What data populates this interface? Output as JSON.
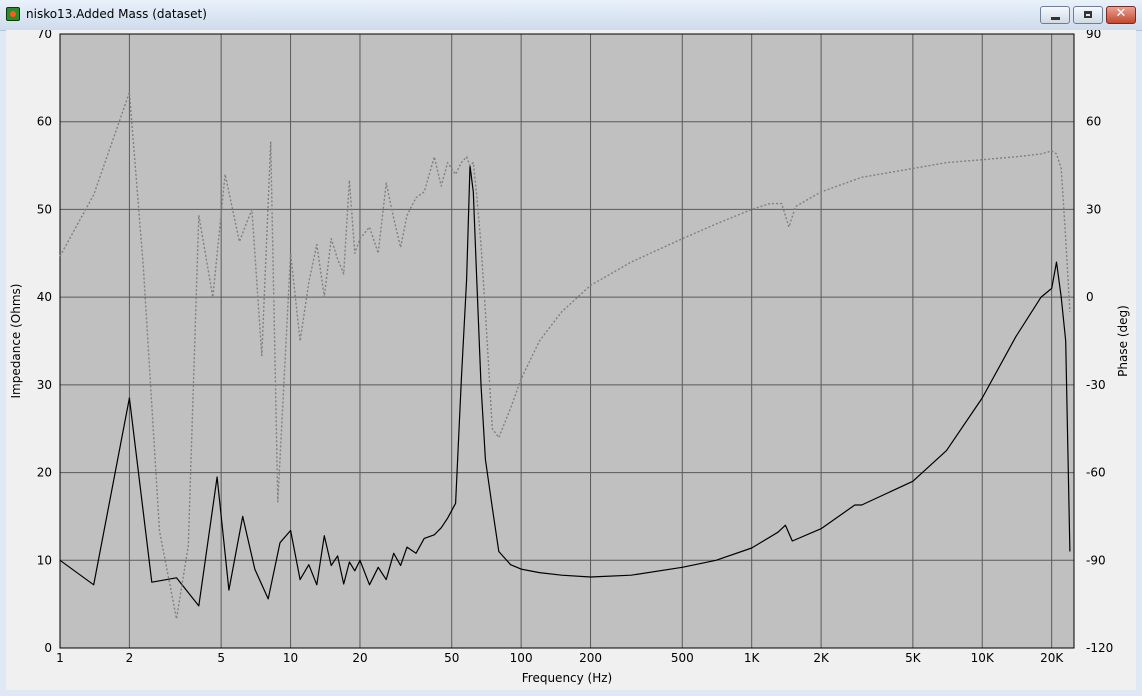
{
  "window": {
    "title": "nisko13.Added Mass (dataset)",
    "icons": [
      "app-icon",
      "minimize-icon",
      "maximize-icon",
      "close-icon"
    ]
  },
  "chart_data": {
    "type": "line",
    "title": "",
    "xlabel": "Frequency (Hz)",
    "ylabel": "Impedance (Ohms)",
    "y2label": "Phase (deg)",
    "xscale": "log",
    "xlim": [
      1,
      25000
    ],
    "ylim": [
      0,
      70
    ],
    "y2lim": [
      -120,
      90
    ],
    "grid": true,
    "legend": "none",
    "plot_background": "#c0c0c0",
    "x_ticks": [
      {
        "value": 1,
        "label": "1"
      },
      {
        "value": 2,
        "label": "2"
      },
      {
        "value": 5,
        "label": "5"
      },
      {
        "value": 10,
        "label": "10"
      },
      {
        "value": 20,
        "label": "20"
      },
      {
        "value": 50,
        "label": "50"
      },
      {
        "value": 100,
        "label": "100"
      },
      {
        "value": 200,
        "label": "200"
      },
      {
        "value": 500,
        "label": "500"
      },
      {
        "value": 1000,
        "label": "1K"
      },
      {
        "value": 2000,
        "label": "2K"
      },
      {
        "value": 5000,
        "label": "5K"
      },
      {
        "value": 10000,
        "label": "10K"
      },
      {
        "value": 20000,
        "label": "20K"
      }
    ],
    "y_ticks": [
      0,
      10,
      20,
      30,
      40,
      50,
      60,
      70
    ],
    "y2_ticks": [
      -120,
      -90,
      -60,
      -30,
      0,
      30,
      60,
      90
    ],
    "series": [
      {
        "axis": "left",
        "color": "#000000",
        "style": "solid",
        "x": [
          1,
          1.4,
          2,
          2.5,
          3.2,
          4,
          4.8,
          5.4,
          6.2,
          7,
          8,
          9,
          10,
          11,
          12,
          13,
          14,
          15,
          16,
          17,
          18,
          19,
          20,
          22,
          24,
          26,
          28,
          30,
          32,
          35,
          38,
          42,
          45,
          48,
          52,
          55,
          58,
          60,
          62,
          64,
          67,
          70,
          75,
          80,
          90,
          100,
          120,
          150,
          200,
          300,
          500,
          700,
          1000,
          1300,
          1400,
          1500,
          2000,
          2800,
          3000,
          5000,
          7000,
          10000,
          14000,
          18000,
          20000,
          21000,
          22000,
          23000,
          23500,
          24000
        ],
        "y": [
          10,
          7.2,
          28.5,
          7.5,
          8,
          4.8,
          19.5,
          6.6,
          15,
          9,
          5.6,
          12,
          13.4,
          7.8,
          9.5,
          7.2,
          12.8,
          9.4,
          10.5,
          7.3,
          9.8,
          8.8,
          10,
          7.2,
          9.2,
          7.8,
          10.8,
          9.4,
          11.5,
          10.8,
          12.5,
          12.9,
          13.7,
          14.8,
          16.5,
          30.5,
          42,
          55,
          52,
          43,
          30,
          21.5,
          16,
          11,
          9.5,
          9,
          8.6,
          8.3,
          8.1,
          8.3,
          9.2,
          10,
          11.4,
          13.2,
          14,
          12.2,
          13.6,
          16.3,
          16.3,
          19,
          22.5,
          28.5,
          35.5,
          40,
          41,
          44,
          40,
          35,
          23,
          11
        ]
      },
      {
        "axis": "right",
        "color": "#808080",
        "style": "dotted",
        "x": [
          1,
          1.4,
          2,
          2.3,
          2.7,
          3.2,
          3.6,
          4,
          4.6,
          5.2,
          6,
          6.8,
          7.5,
          8.2,
          8.8,
          10,
          11,
          12,
          13,
          14,
          15,
          16,
          17,
          18,
          19,
          20,
          22,
          24,
          26,
          28,
          30,
          32,
          35,
          38,
          42,
          45,
          48,
          52,
          55,
          58,
          60,
          62,
          64,
          67,
          70,
          75,
          80,
          90,
          100,
          120,
          150,
          200,
          300,
          500,
          700,
          1000,
          1200,
          1350,
          1450,
          1550,
          2000,
          3000,
          5000,
          7000,
          10000,
          14000,
          18000,
          20000,
          21000,
          22000,
          23000,
          24000
        ],
        "y": [
          14,
          35,
          70,
          10,
          -80,
          -110,
          -85,
          28,
          0,
          42,
          19,
          30,
          -20,
          53,
          -70,
          15,
          -15,
          5,
          18,
          0,
          20,
          13,
          8,
          40,
          15,
          20,
          24,
          15,
          39,
          27,
          17,
          28,
          34,
          36,
          48,
          38,
          46,
          42,
          46,
          48,
          45,
          46,
          36,
          18,
          -5,
          -45,
          -48,
          -38,
          -28,
          -15,
          -5,
          4,
          12,
          20,
          25,
          30,
          32,
          32,
          24,
          31,
          36,
          41,
          44,
          46,
          47,
          48,
          49,
          50,
          49,
          44,
          20,
          -5
        ]
      }
    ]
  }
}
